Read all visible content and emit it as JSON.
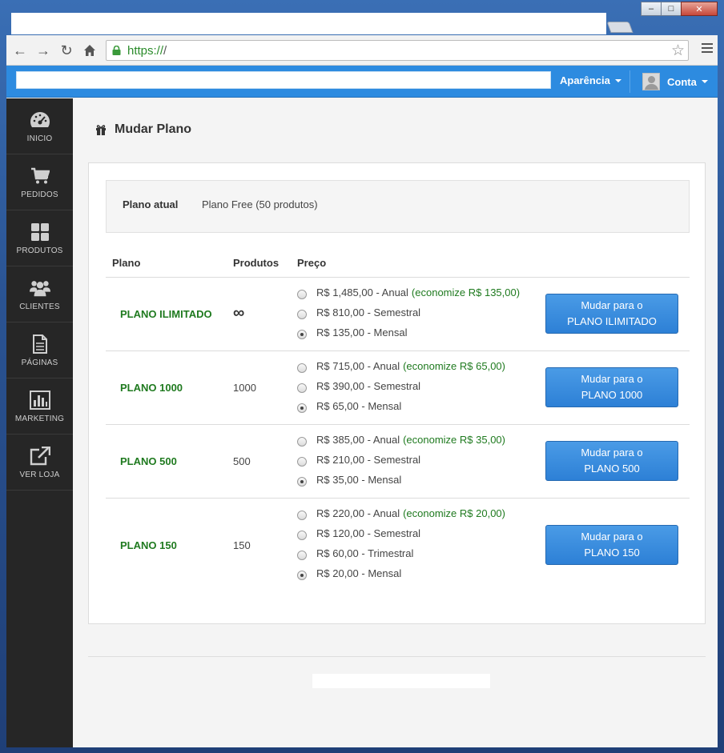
{
  "browser": {
    "url_scheme": "https://",
    "url_rest": "/"
  },
  "header": {
    "appearance": "Aparência",
    "account": "Conta"
  },
  "sidebar": {
    "items": [
      {
        "label": "INICIO",
        "icon": "dashboard-icon"
      },
      {
        "label": "PEDIDOS",
        "icon": "cart-icon"
      },
      {
        "label": "PRODUTOS",
        "icon": "grid-icon"
      },
      {
        "label": "CLIENTES",
        "icon": "users-icon"
      },
      {
        "label": "PÁGINAS",
        "icon": "page-icon"
      },
      {
        "label": "MARKETING",
        "icon": "bar-chart-icon"
      },
      {
        "label": "VER LOJA",
        "icon": "external-link-icon"
      }
    ]
  },
  "page": {
    "title": "Mudar Plano",
    "current_label": "Plano atual",
    "current_value": "Plano Free (50 produtos)",
    "columns": [
      "Plano",
      "Produtos",
      "Preço"
    ]
  },
  "plans": [
    {
      "name": "PLANO ILIMITADO",
      "qty": "∞",
      "options": [
        {
          "text": "R$ 1,485,00 - Anual",
          "save": "(economize R$ 135,00)",
          "selected": false
        },
        {
          "text": "R$ 810,00 - Semestral",
          "save": "",
          "selected": false
        },
        {
          "text": "R$ 135,00 - Mensal",
          "save": "",
          "selected": true
        }
      ],
      "button_line1": "Mudar para o",
      "button_line2": "PLANO ILIMITADO"
    },
    {
      "name": "PLANO 1000",
      "qty": "1000",
      "options": [
        {
          "text": "R$ 715,00 - Anual",
          "save": "(economize R$ 65,00)",
          "selected": false
        },
        {
          "text": "R$ 390,00 - Semestral",
          "save": "",
          "selected": false
        },
        {
          "text": "R$ 65,00 - Mensal",
          "save": "",
          "selected": true
        }
      ],
      "button_line1": "Mudar para o",
      "button_line2": "PLANO 1000"
    },
    {
      "name": "PLANO 500",
      "qty": "500",
      "options": [
        {
          "text": "R$ 385,00 - Anual",
          "save": "(economize R$ 35,00)",
          "selected": false
        },
        {
          "text": "R$ 210,00 - Semestral",
          "save": "",
          "selected": false
        },
        {
          "text": "R$ 35,00 - Mensal",
          "save": "",
          "selected": true
        }
      ],
      "button_line1": "Mudar para o",
      "button_line2": "PLANO 500"
    },
    {
      "name": "PLANO 150",
      "qty": "150",
      "options": [
        {
          "text": "R$ 220,00 - Anual",
          "save": "(economize R$ 20,00)",
          "selected": false
        },
        {
          "text": "R$ 120,00 - Semestral",
          "save": "",
          "selected": false
        },
        {
          "text": "R$ 60,00 - Trimestral",
          "save": "",
          "selected": false
        },
        {
          "text": "R$ 20,00 - Mensal",
          "save": "",
          "selected": true
        }
      ],
      "button_line1": "Mudar para o",
      "button_line2": "PLANO 150"
    }
  ]
}
